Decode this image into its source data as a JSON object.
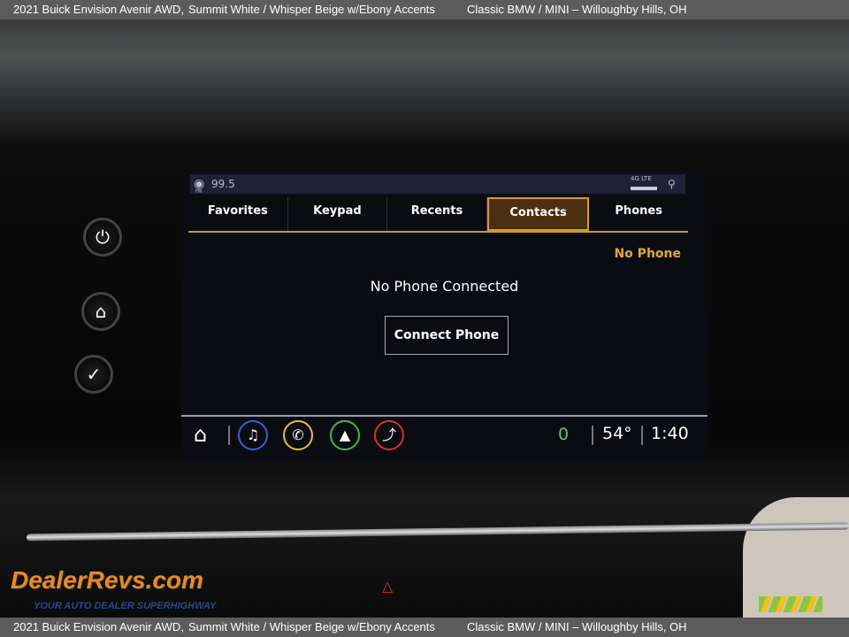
{
  "banner": {
    "vehicle": "2021 Buick Envision Avenir AWD,",
    "colors": "Summit White / Whisper Beige w/Ebony Accents",
    "dealer": "Classic BMW / MINI – Willoughby Hills, OH"
  },
  "status": {
    "band": "FM",
    "frequency": "99.5",
    "network": "4G LTE"
  },
  "tabs": [
    {
      "label": "Favorites"
    },
    {
      "label": "Keypad"
    },
    {
      "label": "Recents"
    },
    {
      "label": "Contacts",
      "active": true
    },
    {
      "label": "Phones"
    }
  ],
  "main": {
    "phone_status": "No Phone",
    "message": "No Phone Connected",
    "connect_label": "Connect Phone"
  },
  "bottom": {
    "notification_count": "0",
    "temperature": "54°",
    "time": "1:40"
  },
  "logo": {
    "name": "DealerRevs.com",
    "tagline": "YOUR AUTO DEALER SUPERHIGHWAY"
  },
  "colors": {
    "accent": "#d69c2a",
    "audio": "#3a5ed8",
    "phone": "#e0c040",
    "nav": "#40b850",
    "climate": "#d83030"
  }
}
